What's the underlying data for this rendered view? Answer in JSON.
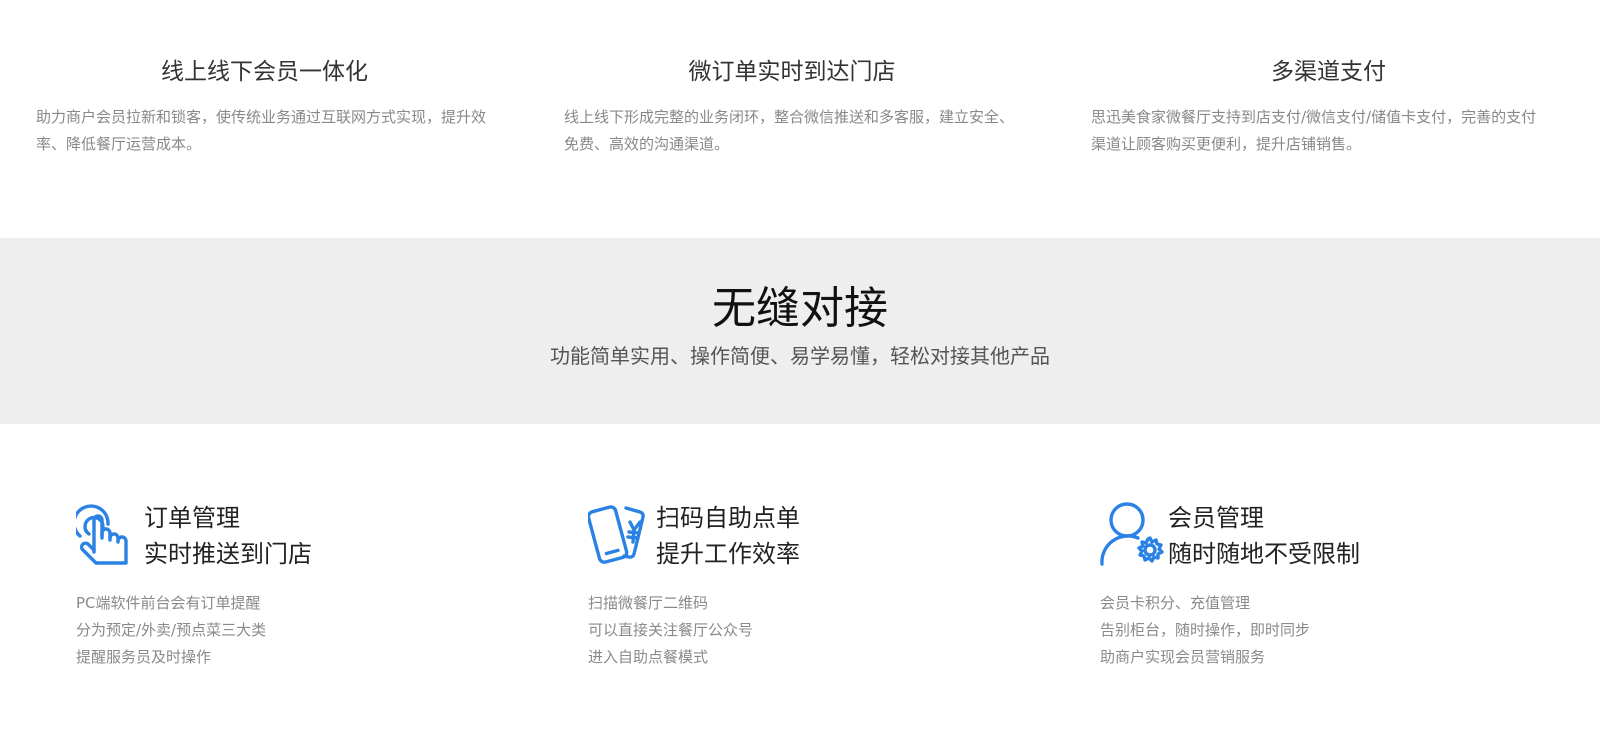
{
  "top_features": [
    {
      "title": "线上线下会员一体化",
      "desc_line1": "助力商户会员拉新和锁客，使传统业务通过互联网方式实现，提升效",
      "desc_line2": "率、降低餐厅运营成本。"
    },
    {
      "title": "微订单实时到达门店",
      "desc_line1": "线上线下形成完整的业务闭环，整合微信推送和多客服，建立安全、",
      "desc_line2": "免费、高效的沟通渠道。"
    },
    {
      "title": "多渠道支付",
      "desc_line1": "思迅美食家微餐厅支持到店支付/微信支付/储值卡支付，完善的支付",
      "desc_line2": "渠道让顾客购买更便利，提升店铺销售。"
    }
  ],
  "banner": {
    "title": "无缝对接",
    "subtitle": "功能简单实用、操作简便、易学易懂，轻松对接其他产品"
  },
  "services": [
    {
      "icon": "tap-hand-icon",
      "heading_line1": "订单管理",
      "heading_line2": "实时推送到门店",
      "lines": [
        "PC端软件前台会有订单提醒",
        "分为预定/外卖/预点菜三大类",
        "提醒服务员及时操作"
      ]
    },
    {
      "icon": "phone-scan-icon",
      "heading_line1": "扫码自助点单",
      "heading_line2": "提升工作效率",
      "lines": [
        "扫描微餐厅二维码",
        "可以直接关注餐厅公众号",
        "进入自助点餐模式"
      ]
    },
    {
      "icon": "user-gear-icon",
      "heading_line1": "会员管理",
      "heading_line2": "随时随地不受限制",
      "lines": [
        "会员卡积分、充值管理",
        "告别柜台，随时操作，即时同步",
        "助商户实现会员营销服务"
      ]
    }
  ],
  "colors": {
    "icon_blue": "#2a82e4",
    "banner_bg": "#eeeeee",
    "muted_text": "#888888"
  }
}
